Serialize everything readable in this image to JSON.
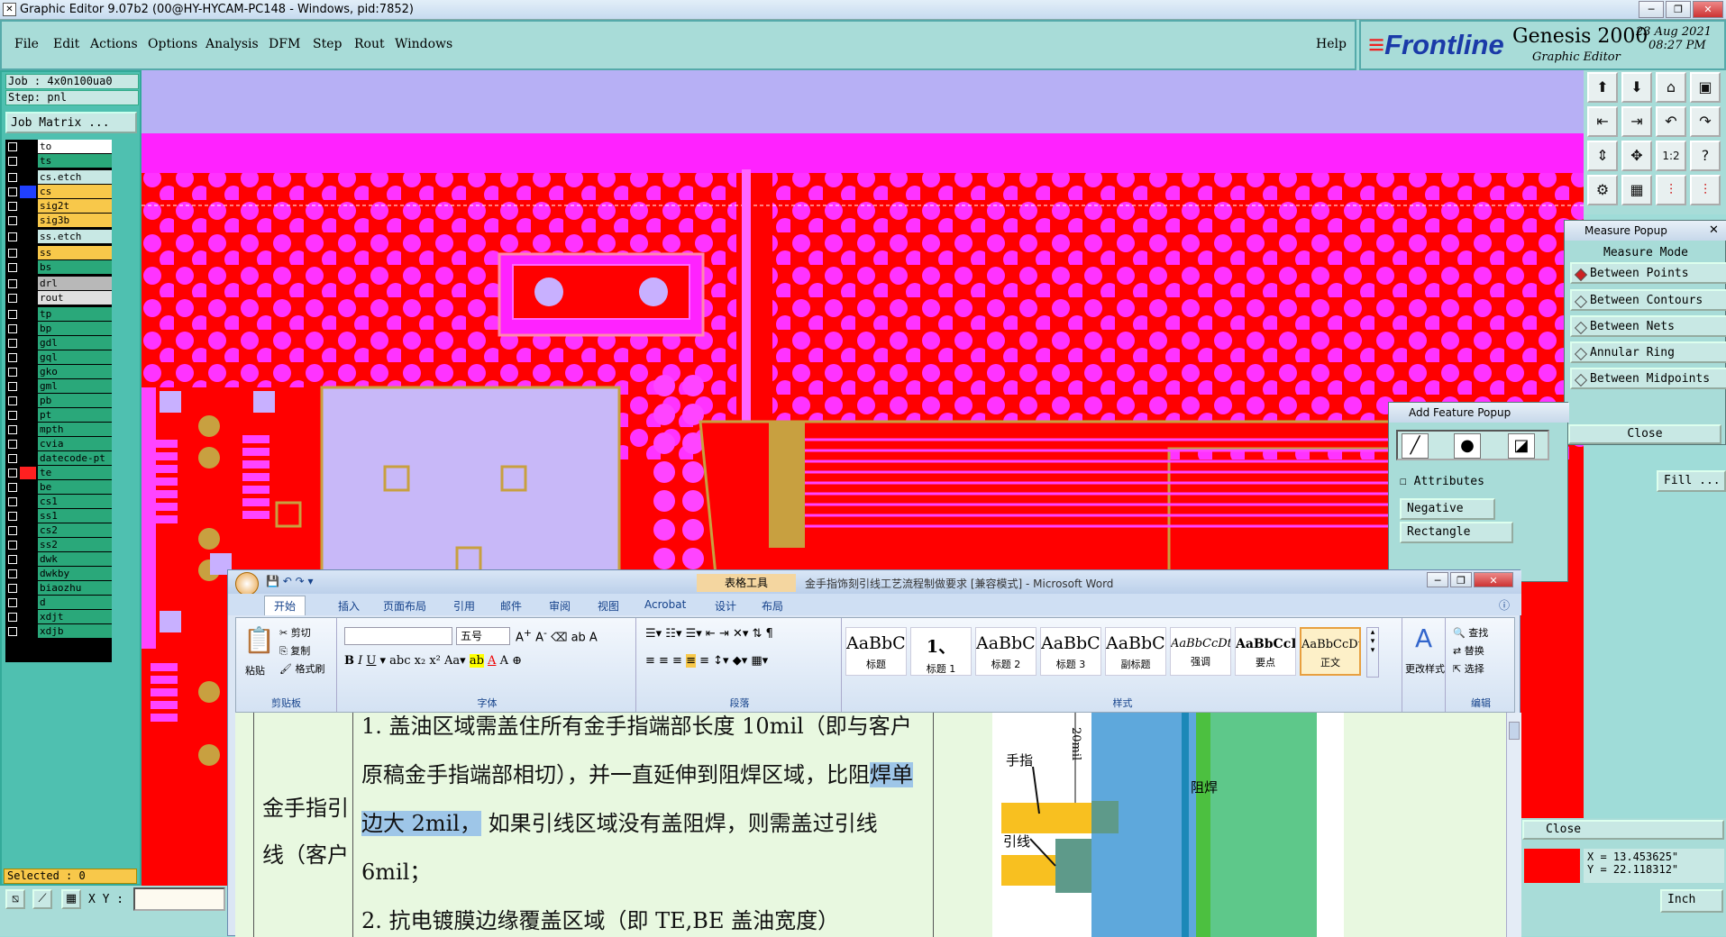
{
  "window": {
    "title": "Graphic Editor 9.07b2 (00@HY-HYCAM-PC148 - Windows, pid:7852)"
  },
  "menu": [
    "File",
    "Edit",
    "Actions",
    "Options",
    "Analysis",
    "DFM",
    "Step",
    "Rout",
    "Windows"
  ],
  "help": "Help",
  "brand": {
    "logo": "Frontline",
    "product": "Genesis 2000",
    "subtitle": "Graphic Editor",
    "date": "23 Aug 2021",
    "time": "08:27 PM"
  },
  "job": {
    "job": "Job : 4x0n100ua0",
    "step": "Step: pnl",
    "matrix": "Job Matrix ..."
  },
  "layers": [
    {
      "name": "to",
      "color": "#ffffff",
      "swatch": "#000000"
    },
    {
      "name": "ts",
      "color": "#2aa87a",
      "swatch": "#000000"
    },
    {
      "name": "cs.etch",
      "color": "#c8e8e4",
      "swatch": "#000000"
    },
    {
      "name": "cs",
      "color": "#f8c84a",
      "swatch": "#2040ff"
    },
    {
      "name": "sig2t",
      "color": "#f8c84a",
      "swatch": "#000000"
    },
    {
      "name": "sig3b",
      "color": "#f8c84a",
      "swatch": "#000000"
    },
    {
      "name": "ss.etch",
      "color": "#c8e8e4",
      "swatch": "#000000"
    },
    {
      "name": "ss",
      "color": "#f8c84a",
      "swatch": "#000000"
    },
    {
      "name": "bs",
      "color": "#2aa87a",
      "swatch": "#000000"
    },
    {
      "name": "drl",
      "color": "#b8b8b8",
      "swatch": "#000000"
    },
    {
      "name": "rout",
      "color": "#e0e0e0",
      "swatch": "#000000"
    },
    {
      "name": "tp",
      "color": "#2aa87a",
      "swatch": "#000000"
    },
    {
      "name": "bp",
      "color": "#2aa87a",
      "swatch": "#000000"
    },
    {
      "name": "gdl",
      "color": "#2aa87a",
      "swatch": "#000000"
    },
    {
      "name": "gql",
      "color": "#2aa87a",
      "swatch": "#000000"
    },
    {
      "name": "gko",
      "color": "#2aa87a",
      "swatch": "#000000"
    },
    {
      "name": "gml",
      "color": "#2aa87a",
      "swatch": "#000000"
    },
    {
      "name": "pb",
      "color": "#2aa87a",
      "swatch": "#000000"
    },
    {
      "name": "pt",
      "color": "#2aa87a",
      "swatch": "#000000"
    },
    {
      "name": "mpth",
      "color": "#2aa87a",
      "swatch": "#000000"
    },
    {
      "name": "cvia",
      "color": "#2aa87a",
      "swatch": "#000000"
    },
    {
      "name": "datecode-pt",
      "color": "#2aa87a",
      "swatch": "#000000"
    },
    {
      "name": "te",
      "color": "#2aa87a",
      "swatch": "#ff2020"
    },
    {
      "name": "be",
      "color": "#2aa87a",
      "swatch": "#000000"
    },
    {
      "name": "cs1",
      "color": "#2aa87a",
      "swatch": "#000000"
    },
    {
      "name": "ss1",
      "color": "#2aa87a",
      "swatch": "#000000"
    },
    {
      "name": "cs2",
      "color": "#2aa87a",
      "swatch": "#000000"
    },
    {
      "name": "ss2",
      "color": "#2aa87a",
      "swatch": "#000000"
    },
    {
      "name": "dwk",
      "color": "#2aa87a",
      "swatch": "#000000"
    },
    {
      "name": "dwkby",
      "color": "#2aa87a",
      "swatch": "#000000"
    },
    {
      "name": "biaozhu",
      "color": "#2aa87a",
      "swatch": "#000000"
    },
    {
      "name": "d",
      "color": "#2aa87a",
      "swatch": "#000000"
    },
    {
      "name": "xdjt",
      "color": "#2aa87a",
      "swatch": "#000000"
    },
    {
      "name": "xdjb",
      "color": "#2aa87a",
      "swatch": "#000000"
    }
  ],
  "status": {
    "selected": "Selected : 0",
    "xy_label": "X Y :",
    "x": "X = 13.453625\"",
    "y": "Y = 22.118312\"",
    "units": "Inch"
  },
  "measure": {
    "title": "Measure Popup",
    "mode_label": "Measure Mode",
    "modes": [
      "Between Points",
      "Between Contours",
      "Between Nets",
      "Annular Ring",
      "Between Midpoints"
    ],
    "close": "Close"
  },
  "addfeature": {
    "title": "Add Feature Popup",
    "attributes": "Attributes",
    "fill": "Fill ...",
    "polarity": "Negative",
    "shape": "Rectangle",
    "close": "Close"
  },
  "word": {
    "title": "金手指饰刻引线工艺流程制做要求 [兼容模式] - Microsoft Word",
    "context_tab": "表格工具",
    "tabs": [
      "开始",
      "插入",
      "页面布局",
      "引用",
      "邮件",
      "审阅",
      "视图",
      "Acrobat",
      "设计",
      "布局"
    ],
    "clipboard": {
      "paste": "粘贴",
      "cut": "剪切",
      "copy": "复制",
      "format": "格式刷",
      "label": "剪贴板"
    },
    "font": {
      "size": "五号",
      "label": "字体"
    },
    "paragraph_label": "段落",
    "styles": [
      {
        "preview": "AaBbC(",
        "name": "标题"
      },
      {
        "preview": "1、",
        "name": "标题 1"
      },
      {
        "preview": "AaBbC(",
        "name": "标题 2"
      },
      {
        "preview": "AaBbC(",
        "name": "标题 3"
      },
      {
        "preview": "AaBbC(",
        "name": "副标题"
      },
      {
        "preview": "AaBbCcDt",
        "name": "强调"
      },
      {
        "preview": "AaBbCcD",
        "name": "要点"
      },
      {
        "preview": "AaBbCcDt",
        "name": "正文"
      }
    ],
    "styles_label": "样式",
    "change_styles": "更改样式",
    "edit": {
      "find": "查找",
      "replace": "替换",
      "select": "选择",
      "label": "编辑"
    },
    "cell_left": [
      "金手指引",
      "线（客户"
    ],
    "para1": "1.  盖油区域需盖住所有金手指端部长度 10mil（即与客户原稿金手指端部相切），并一直延伸到阻焊区域，比阻",
    "para1_hl": "焊单边大 2mil，",
    "para1_end": "  如果引线区域没有盖阻焊，则需盖过引线 6mil；",
    "para2": "2.  抗电镀膜边缘覆盖区域（即 TE,BE 盖油宽度）",
    "fig": {
      "finger": "手指",
      "lead": "引线",
      "mask": "阻焊",
      "dim": "20mil"
    }
  }
}
